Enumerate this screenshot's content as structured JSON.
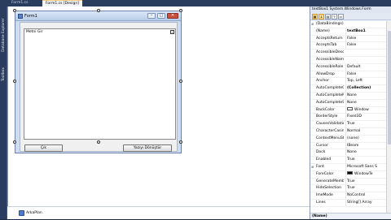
{
  "side_tabs": [
    "Database Explorer",
    "Toolbox"
  ],
  "doc_tabs": [
    {
      "label": "Form1.cs",
      "active": false
    },
    {
      "label": "Form1.cs [Design]",
      "active": true
    }
  ],
  "form": {
    "title": "Form1",
    "textbox_text": "Metni Gir",
    "exit_button": "Çık",
    "save_button": "Yazıyı Dönüştür"
  },
  "tray": {
    "item": "ArkaPlan"
  },
  "properties": {
    "header": "textBox1 System.Windows.Form",
    "rows": [
      {
        "exp": "⊞",
        "name": "(DataBindings)",
        "value": "",
        "bold": false
      },
      {
        "exp": "",
        "name": "(Name)",
        "value": "textBox1",
        "bold": true
      },
      {
        "exp": "",
        "name": "AcceptsReturn",
        "value": "False",
        "bold": false
      },
      {
        "exp": "",
        "name": "AcceptsTab",
        "value": "False",
        "bold": false
      },
      {
        "exp": "",
        "name": "AccessibleDescription",
        "value": "",
        "bold": false
      },
      {
        "exp": "",
        "name": "AccessibleName",
        "value": "",
        "bold": false
      },
      {
        "exp": "",
        "name": "AccessibleRole",
        "value": "Default",
        "bold": false
      },
      {
        "exp": "",
        "name": "AllowDrop",
        "value": "False",
        "bold": false
      },
      {
        "exp": "",
        "name": "Anchor",
        "value": "Top, Left",
        "bold": false
      },
      {
        "exp": "",
        "name": "AutoCompleteCustomSource",
        "value": "(Collection)",
        "bold": true
      },
      {
        "exp": "",
        "name": "AutoCompleteMode",
        "value": "None",
        "bold": false
      },
      {
        "exp": "",
        "name": "AutoCompleteSource",
        "value": "None",
        "bold": false
      },
      {
        "exp": "",
        "name": "BackColor",
        "value": "Window",
        "bold": false,
        "swatch": "#ffffff"
      },
      {
        "exp": "",
        "name": "BorderStyle",
        "value": "Fixed3D",
        "bold": false
      },
      {
        "exp": "",
        "name": "CausesValidation",
        "value": "True",
        "bold": false
      },
      {
        "exp": "",
        "name": "CharacterCasing",
        "value": "Normal",
        "bold": false
      },
      {
        "exp": "",
        "name": "ContextMenuStrip",
        "value": "(none)",
        "bold": false
      },
      {
        "exp": "",
        "name": "Cursor",
        "value": "IBeam",
        "bold": false
      },
      {
        "exp": "",
        "name": "Dock",
        "value": "None",
        "bold": false
      },
      {
        "exp": "",
        "name": "Enabled",
        "value": "True",
        "bold": false
      },
      {
        "exp": "⊞",
        "name": "Font",
        "value": "Microsoft Sans S",
        "bold": false
      },
      {
        "exp": "",
        "name": "ForeColor",
        "value": "WindowTe",
        "bold": false,
        "swatch": "#000000"
      },
      {
        "exp": "",
        "name": "GenerateMember",
        "value": "True",
        "bold": false
      },
      {
        "exp": "",
        "name": "HideSelection",
        "value": "True",
        "bold": false
      },
      {
        "exp": "",
        "name": "ImeMode",
        "value": "NoControl",
        "bold": false
      },
      {
        "exp": "",
        "name": "Lines",
        "value": "String[] Array",
        "bold": false
      }
    ],
    "footer": "(Name)"
  }
}
